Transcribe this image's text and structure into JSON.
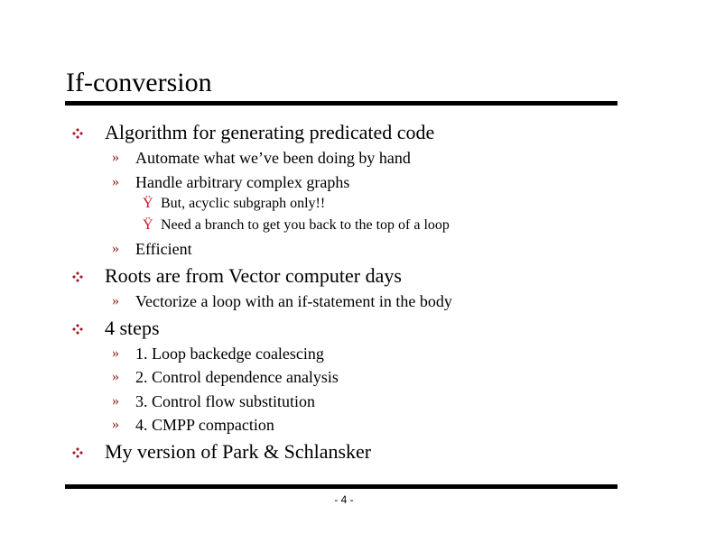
{
  "slide": {
    "title": "If-conversion",
    "bullets": [
      {
        "text": "Algorithm for generating predicated code",
        "sub": [
          {
            "text": "Automate what we’ve  been doing by hand"
          },
          {
            "text": "Handle arbitrary complex graphs",
            "sub": [
              {
                "text": "But, acyclic subgraph only!!"
              },
              {
                "text": "Need a branch to get you back to the top of a loop"
              }
            ]
          },
          {
            "text": "Efficient"
          }
        ]
      },
      {
        "text": "Roots are from Vector computer days",
        "sub": [
          {
            "text": "Vectorize a loop with an if-statement in the body"
          }
        ]
      },
      {
        "text": "4 steps",
        "sub": [
          {
            "text": "1. Loop backedge coalescing"
          },
          {
            "text": "2. Control dependence analysis"
          },
          {
            "text": "3. Control flow substitution"
          },
          {
            "text": "4. CMPP compaction"
          }
        ]
      },
      {
        "text": "My version of Park & Schlansker"
      }
    ],
    "bullet_glyphs": {
      "level1": "four-diamond-icon",
      "level2": "»",
      "level3": "Ÿ"
    },
    "colors": {
      "bullet_level1": "#a01c28",
      "bullet_level2": "#8b1a1a",
      "bullet_level3": "#c0182a",
      "rule": "#000000"
    },
    "page_number": "- 4 -"
  }
}
